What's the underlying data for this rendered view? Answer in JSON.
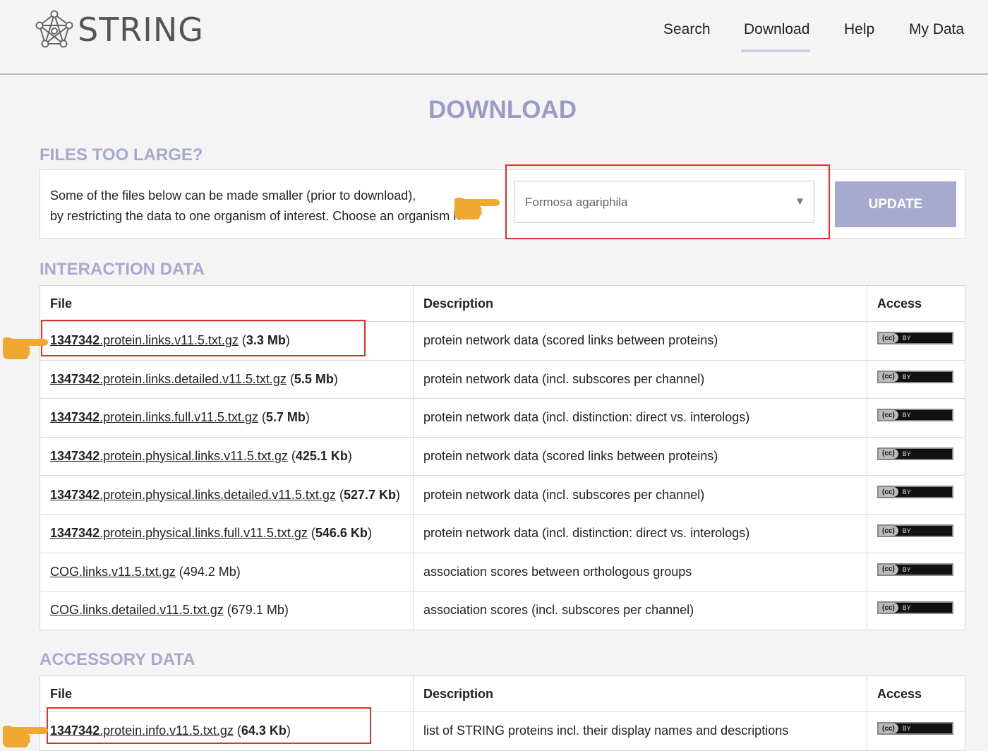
{
  "header": {
    "logo_text": "STRING",
    "nav": [
      {
        "label": "Search"
      },
      {
        "label": "Download",
        "active": true
      },
      {
        "label": "Help"
      },
      {
        "label": "My Data"
      }
    ]
  },
  "page_title": "DOWNLOAD",
  "files_too_large": {
    "heading": "FILES TOO LARGE?",
    "text_line1": "Some of the files below can be made smaller (prior to download),",
    "text_line2": "by restricting the data to one organism of interest. Choose an organism h",
    "organism_select_value": "Formosa agariphila",
    "update_label": "UPDATE"
  },
  "interaction": {
    "heading": "INTERACTION DATA",
    "headers": {
      "file": "File",
      "description": "Description",
      "access": "Access"
    },
    "rows": [
      {
        "prefix": "1347342",
        "name": ".protein.links.v11.5.txt.gz",
        "size": "3.3 Mb",
        "desc": "protein network data (scored links between proteins)"
      },
      {
        "prefix": "1347342",
        "name": ".protein.links.detailed.v11.5.txt.gz",
        "size": "5.5 Mb",
        "desc": "protein network data (incl. subscores per channel)"
      },
      {
        "prefix": "1347342",
        "name": ".protein.links.full.v11.5.txt.gz",
        "size": "5.7 Mb",
        "desc": "protein network data (incl. distinction: direct vs. interologs)"
      },
      {
        "prefix": "1347342",
        "name": ".protein.physical.links.v11.5.txt.gz",
        "size": "425.1 Kb",
        "desc": "protein network data (scored links between proteins)"
      },
      {
        "prefix": "1347342",
        "name": ".protein.physical.links.detailed.v11.5.txt.gz",
        "size": "527.7 Kb",
        "desc": "protein network data (incl. subscores per channel)"
      },
      {
        "prefix": "1347342",
        "name": ".protein.physical.links.full.v11.5.txt.gz",
        "size": "546.6 Kb",
        "desc": "protein network data (incl. distinction: direct vs. interologs)"
      },
      {
        "name": "COG.links.v11.5.txt.gz",
        "size": "494.2 Mb",
        "desc": "association scores between orthologous groups"
      },
      {
        "name": "COG.links.detailed.v11.5.txt.gz",
        "size": "679.1 Mb",
        "desc": "association scores (incl. subscores per channel)"
      }
    ]
  },
  "accessory": {
    "heading": "ACCESSORY DATA",
    "headers": {
      "file": "File",
      "description": "Description",
      "access": "Access"
    },
    "rows": [
      {
        "prefix": "1347342",
        "name": ".protein.info.v11.5.txt.gz",
        "size": "64.3 Kb",
        "desc": "list of STRING proteins incl. their display names and descriptions"
      }
    ]
  },
  "license_badge": {
    "left": "(cc)",
    "right": "BY"
  },
  "colors": {
    "accent": "#a7a9cf",
    "highlight": "#d9342b",
    "pointer": "#f0a830"
  }
}
